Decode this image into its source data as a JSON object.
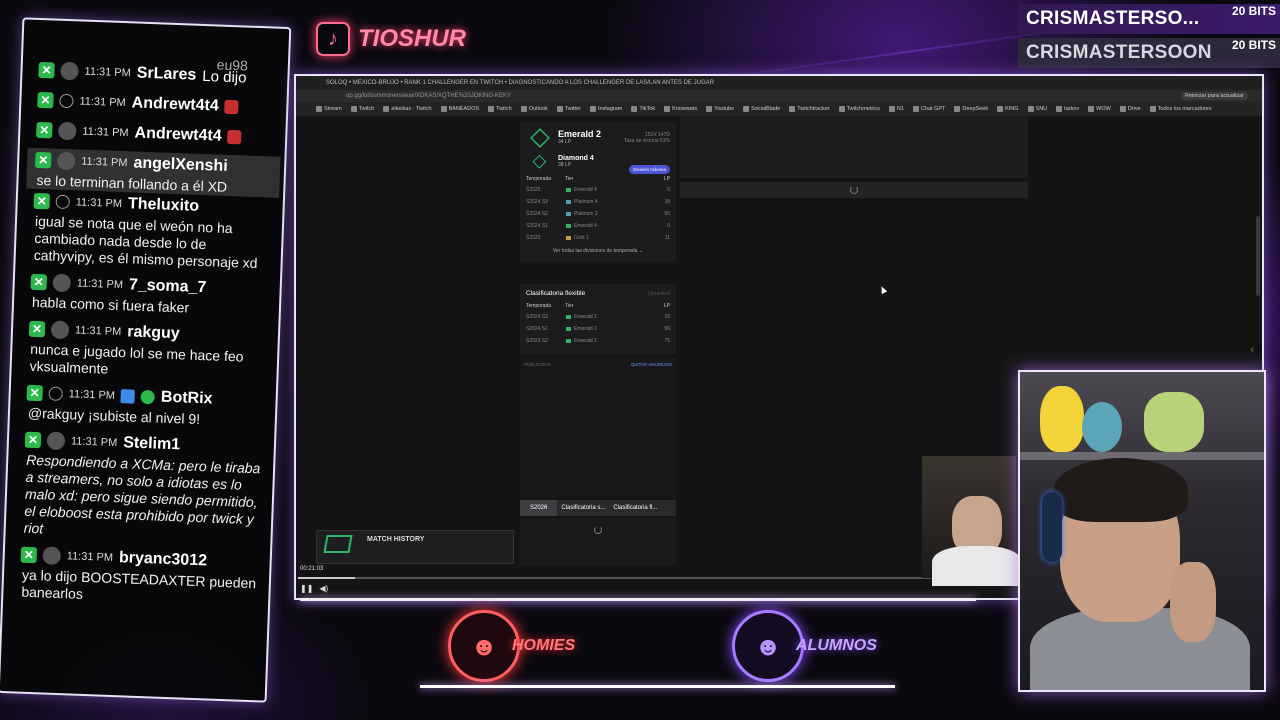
{
  "brand": {
    "icon": "tiktok-icon",
    "name": "TIOSHUR"
  },
  "subs": [
    {
      "name": "CRISMASTERSO...",
      "bits": "20 BITS"
    },
    {
      "name": "CRISMASTERSOON",
      "bits": "20 BITS"
    }
  ],
  "chat": {
    "top_cut": "eu98",
    "messages": [
      {
        "time": "11:31 PM",
        "user": "SrLares",
        "tail": "Lo dijo",
        "text": ""
      },
      {
        "time": "11:31 PM",
        "user": "Andrewt4t4",
        "tail": "",
        "text": ""
      },
      {
        "time": "11:31 PM",
        "user": "Andrewt4t4",
        "tail": "",
        "text": ""
      },
      {
        "time": "11:31 PM",
        "user": "angelXenshi",
        "tail": "",
        "text": "se lo terminan follando a él XD"
      },
      {
        "time": "11:31 PM",
        "user": "Theluxito",
        "tail": "",
        "text": "igual se nota que el weón no ha cambiado nada desde lo de cathyvipy, es él mismo personaje xd"
      },
      {
        "time": "11:31 PM",
        "user": "7_soma_7",
        "tail": "",
        "text": "habla como si fuera faker"
      },
      {
        "time": "11:31 PM",
        "user": "rakguy",
        "tail": "",
        "text": "nunca e jugado lol se me hace feo vksualmente"
      },
      {
        "time": "11:31 PM",
        "user": "BotRix",
        "tail": "",
        "text": "@rakguy ¡subiste al nivel 9!"
      },
      {
        "time": "11:31 PM",
        "user": "Stelim1",
        "tail": "",
        "text": "Respondiendo a XCMa: pero le tiraba a streamers, no solo a idiotas es lo malo xd: pero sigue siendo permitido, el eloboost esta prohibido por twick y riot"
      },
      {
        "time": "11:31 PM",
        "user": "bryanc3012",
        "tail": "",
        "text": "ya lo dijo BOOSTEADAXTER pueden banearlos"
      }
    ]
  },
  "browser": {
    "tabs": "SOLOQ • MEXICO-BRUJO • RANK 1 CHALLENGER EN TWITCH • DIAGNOSTICANDO A LOS CHALLENGER DE LAS/LAN ANTES DE JUGAR",
    "url": "op.gg/lol/summoners/euw/XDKAS/XQTHE%20JOKING-KEKY",
    "url_right": "Reiniciar para actualizar",
    "bookmarks": [
      "Stream",
      "Twitch",
      "elkeikas · Twitch",
      "BANEADOS",
      "Twitch",
      "Outlook",
      "Twitter",
      "Instagram",
      "TikTok",
      "Knowwats",
      "Youtube",
      "SocialBlade",
      "Twitchtracker",
      "Twitchmetrics",
      "N1",
      "Chat GPT",
      "DeepSeek",
      "KING",
      "SNU",
      "tarkov",
      "WOW",
      "Drive",
      "Todos los marcadores"
    ]
  },
  "opgg": {
    "rank1": {
      "name": "Emerald 2",
      "lp": "34 LP",
      "meta1": "151V 147D",
      "meta2": "Tasa de victoria 51%"
    },
    "rank2": {
      "name": "Diamond 4",
      "lp": "38 LP",
      "badge": "División máxima"
    },
    "table_head": {
      "season": "Temporada",
      "tier": "Tier",
      "lp": "LP"
    },
    "history": [
      {
        "season": "S2025",
        "tier": "Emerald 4",
        "lp": "0",
        "color": "#2ab86a"
      },
      {
        "season": "S2024 S3",
        "tier": "Platinum 4",
        "lp": "18",
        "color": "#4ba3b0"
      },
      {
        "season": "S2024 S2",
        "tier": "Platinum 2",
        "lp": "50",
        "color": "#4ba3b0"
      },
      {
        "season": "S2024 S1",
        "tier": "Emerald 4",
        "lp": "0",
        "color": "#2ab86a"
      },
      {
        "season": "S2023",
        "tier": "Gold 1",
        "lp": "11",
        "color": "#c89b3c"
      }
    ],
    "view_all": "Ver todas las divisiones de temporada ⌄",
    "flex": {
      "title": "Clasificatoria flexible",
      "right": "Unranked",
      "rows": [
        {
          "season": "S2024 S3",
          "tier": "Emerald 1",
          "lp": "16",
          "color": "#2ab86a"
        },
        {
          "season": "S2024 S1",
          "tier": "Emerald 2",
          "lp": "56",
          "color": "#2ab86a"
        },
        {
          "season": "S2023 S2",
          "tier": "Emerald 1",
          "lp": "75",
          "color": "#2ab86a"
        }
      ]
    },
    "ad_label": "PUBLICIDAD",
    "ad_remove": "QUITAR ANUNCIOS",
    "tabs": [
      "S2026",
      "Clasificatoria s...",
      "Clasificatoria fl..."
    ],
    "match_history": "MATCH HISTORY"
  },
  "player": {
    "time": "00:21:03",
    "progress": 0.06
  },
  "logos": [
    {
      "name": "HOMIES",
      "icon": "homies-logo-icon"
    },
    {
      "name": "ALUMNOS",
      "icon": "alumnos-logo-icon"
    }
  ]
}
